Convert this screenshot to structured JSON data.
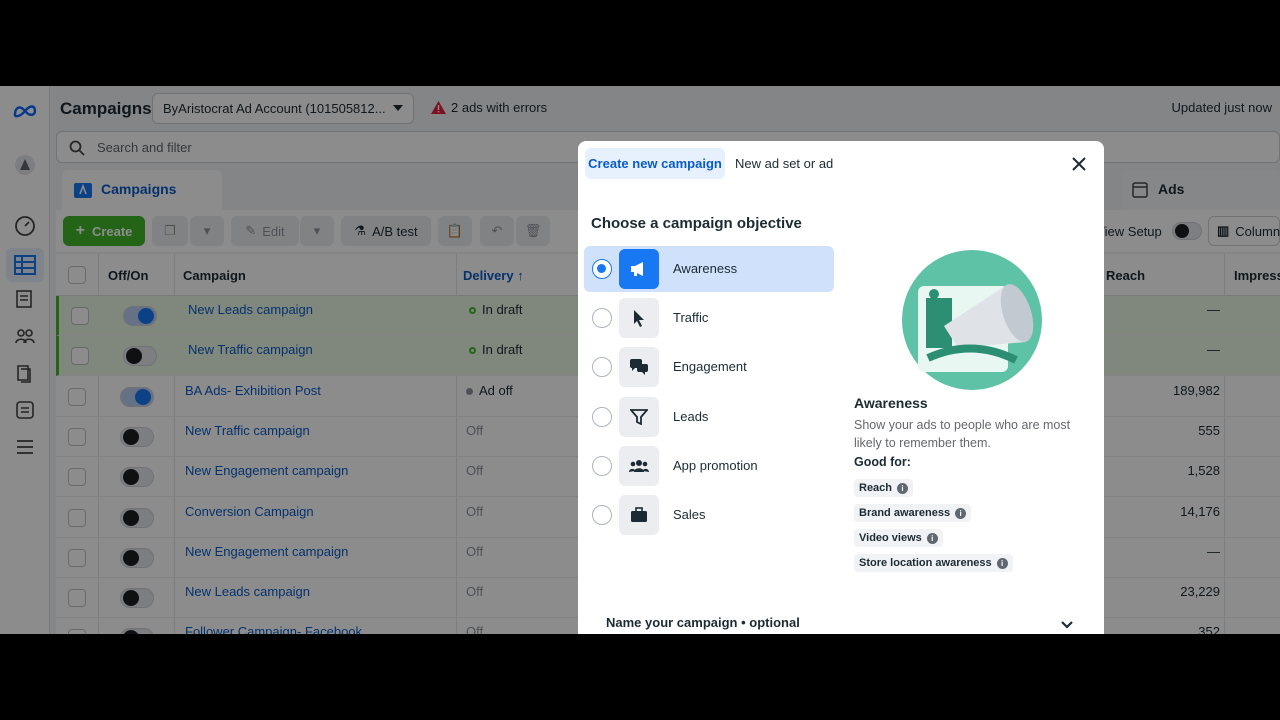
{
  "header": {
    "page_title": "Campaigns",
    "account_select_value": "ByAristocrat Ad Account (101505812...",
    "errors_text": "2 ads with errors",
    "updated_text": "Updated just now"
  },
  "search": {
    "placeholder": "Search and filter"
  },
  "tabs": {
    "campaigns": "Campaigns",
    "ads": "Ads"
  },
  "toolbar": {
    "create_label": "Create",
    "edit_label": "Edit",
    "ab_test_label": "A/B test",
    "view_setup_label": "View Setup",
    "columns_label": "Column"
  },
  "table": {
    "headers": {
      "offon": "Off/On",
      "campaign": "Campaign",
      "delivery": "Delivery ↑",
      "reach": "Reach",
      "impressions": "Impress"
    },
    "rows": [
      {
        "name": "New Leads campaign",
        "delivery": "In draft",
        "reach": "—",
        "on": true,
        "draft": true
      },
      {
        "name": "New Traffic campaign",
        "delivery": "In draft",
        "reach": "—",
        "on": false,
        "draft": true
      },
      {
        "name": "BA Ads- Exhibition Post",
        "delivery": "Ad off",
        "reach": "189,982",
        "on": true,
        "draft": false
      },
      {
        "name": "New Traffic campaign",
        "delivery": "Off",
        "reach": "555",
        "on": false,
        "draft": false
      },
      {
        "name": "New Engagement campaign",
        "delivery": "Off",
        "reach": "1,528",
        "on": false,
        "draft": false
      },
      {
        "name": "Conversion Campaign",
        "delivery": "Off",
        "reach": "14,176",
        "on": false,
        "draft": false
      },
      {
        "name": "New Engagement campaign",
        "delivery": "Off",
        "reach": "—",
        "on": false,
        "draft": false
      },
      {
        "name": "New Leads campaign",
        "delivery": "Off",
        "reach": "23,229",
        "on": false,
        "draft": false
      },
      {
        "name": "Follower Campaign- Facebook",
        "delivery": "Off",
        "reach": "352",
        "on": false,
        "draft": false
      }
    ]
  },
  "modal": {
    "tab_create": "Create new campaign",
    "tab_newadset": "New ad set or ad",
    "objective_title": "Choose a campaign objective",
    "objectives": [
      {
        "label": "Awareness",
        "icon": "megaphone-icon",
        "selected": true
      },
      {
        "label": "Traffic",
        "icon": "cursor-icon",
        "selected": false
      },
      {
        "label": "Engagement",
        "icon": "chat-bubbles-icon",
        "selected": false
      },
      {
        "label": "Leads",
        "icon": "funnel-icon",
        "selected": false
      },
      {
        "label": "App promotion",
        "icon": "people-icon",
        "selected": false
      },
      {
        "label": "Sales",
        "icon": "briefcase-icon",
        "selected": false
      }
    ],
    "desc_title": "Awareness",
    "desc_text": "Show your ads to people who are most likely to remember them.",
    "good_for_label": "Good for:",
    "good_for": [
      "Reach",
      "Brand awareness",
      "Video views",
      "Store location awareness"
    ],
    "name_section": "Name your campaign • optional"
  },
  "colors": {
    "accent": "#1877f2",
    "create_green": "#42b72a",
    "link": "#0a5cc5"
  }
}
